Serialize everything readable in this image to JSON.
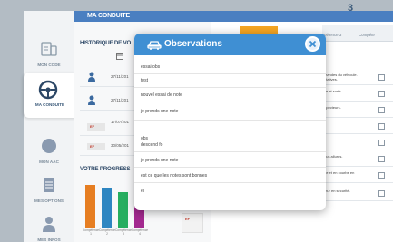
{
  "header": {
    "title": "MA CONDUITE"
  },
  "sidebar": {
    "items": [
      {
        "label": "MON CODE",
        "icon": "car-code-icon"
      },
      {
        "label": "MA CONDUITE",
        "icon": "steering-wheel-icon"
      },
      {
        "label": "MON AAC",
        "icon": "circle-icon"
      },
      {
        "label": "MES OPTIONS",
        "icon": "document-icon"
      },
      {
        "label": "MES INFOS",
        "icon": "user-icon"
      }
    ]
  },
  "history": {
    "title": "HISTORIQUE DE VO",
    "rows": [
      {
        "date": "27/11/201"
      },
      {
        "date": "27/11/201"
      },
      {
        "date": "17/07/201",
        "badge": "EF"
      },
      {
        "date": "30/05/201",
        "badge": "EF"
      }
    ]
  },
  "progress": {
    "title": "VOTRE PROGRESS",
    "bars": [
      {
        "label": "Compétence 1",
        "color": "#e67e22",
        "value": 0.95
      },
      {
        "label": "Compétence 2",
        "color": "#2e86c1",
        "value": 0.9
      },
      {
        "label": "Compétence 3",
        "color": "#27ae60",
        "value": 0.8
      },
      {
        "label": "Compétence 4",
        "color": "#a3298f",
        "value": 0.5
      }
    ]
  },
  "competences": {
    "tabs": [
      "pétence 3",
      "3",
      "Compéte"
    ],
    "rows": [
      "mandes du véhicule. ntatives.",
      "ite et sortir.",
      "apecteurs.",
      "",
      "",
      "ous allures.",
      "ue et en courbe en",
      "mur en sécurité."
    ]
  },
  "modal": {
    "title": "Observations",
    "lines": [
      "essai obs",
      "test",
      "nouvel essai de note",
      "je prends une note",
      "obs",
      "descend fo",
      "je prends une note",
      "est ce que les notes sont bonnes",
      "ei"
    ]
  },
  "colors": {
    "header_blue": "#4a7fc1",
    "modal_blue": "#3f8fd3",
    "accent_orange": "#f5a623"
  }
}
